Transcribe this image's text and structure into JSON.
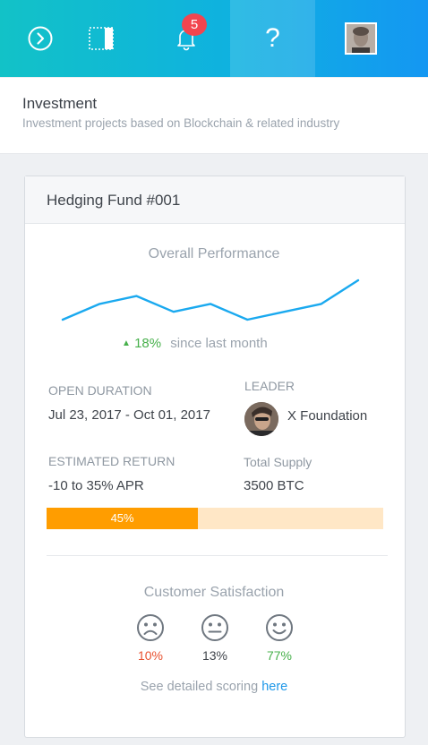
{
  "topbar": {
    "notification_count": "5",
    "help_label": "?",
    "icons": [
      "arrow-circle-right-icon",
      "sidebar-toggle-icon",
      "bell-icon",
      "help-icon",
      "user-avatar"
    ]
  },
  "header": {
    "title": "Investment",
    "subtitle": "Investment projects based on Blockchain & related industry"
  },
  "card": {
    "title": "Hedging Fund #001",
    "performance": {
      "title": "Overall Performance",
      "change": "18%",
      "change_caption": "since last month",
      "trend_values": [
        3,
        5,
        6,
        4,
        5,
        3,
        4,
        5,
        8
      ]
    },
    "open_duration": {
      "label": "OPEN DURATION",
      "value": "Jul 23, 2017 - Oct 01, 2017"
    },
    "leader": {
      "label": "LEADER",
      "name": "X Foundation"
    },
    "estimated_return": {
      "label": "ESTIMATED RETURN",
      "value": "-10 to 35% APR"
    },
    "total_supply": {
      "label": "Total Supply",
      "value": "3500 BTC"
    },
    "progress": {
      "value": 45,
      "label": "45%"
    },
    "satisfaction": {
      "title": "Customer Satisfaction",
      "items": [
        {
          "icon": "sad-face-icon",
          "value": "10%",
          "color": "#e8512f"
        },
        {
          "icon": "neutral-face-icon",
          "value": "13%",
          "color": "#3f444b"
        },
        {
          "icon": "happy-face-icon",
          "value": "77%",
          "color": "#47b04b"
        }
      ],
      "scoring_text": "See detailed scoring",
      "scoring_link": "here"
    }
  },
  "colors": {
    "accent": "#1d97e8",
    "progress": "#ff9d00",
    "progress_bg": "#ffe7c6",
    "line": "#1aa9ef"
  }
}
